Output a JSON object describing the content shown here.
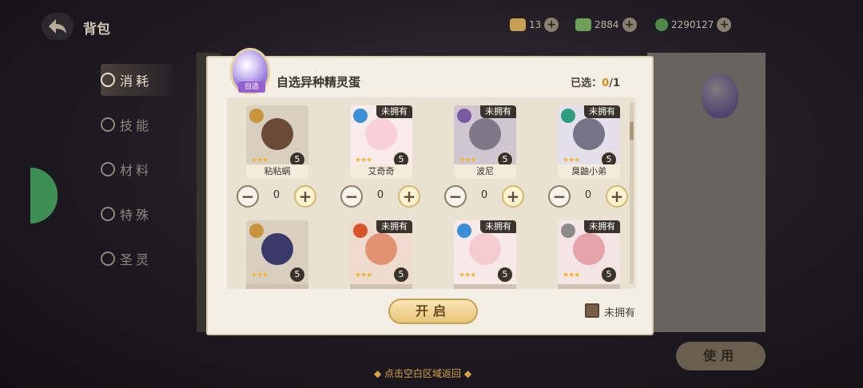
{
  "header": {
    "title": "背包",
    "currencies": [
      {
        "name": "gold-ticket",
        "value": "13"
      },
      {
        "name": "green-gem",
        "value": "2884"
      },
      {
        "name": "coin",
        "value": "2290127"
      }
    ]
  },
  "sidebar": {
    "items": [
      {
        "label": "消耗",
        "active": true
      },
      {
        "label": "技能",
        "active": false
      },
      {
        "label": "材料",
        "active": false
      },
      {
        "label": "特殊",
        "active": false
      },
      {
        "label": "圣灵",
        "active": false
      }
    ]
  },
  "dialog": {
    "title": "自选异种精灵蛋",
    "egg_tag": "自选",
    "selected_label": "已选：",
    "selected_count": "0",
    "selected_total": "/1",
    "open_button": "开启",
    "filter_label": "未拥有",
    "filter_checked": true,
    "not_owned_tag": "未拥有",
    "pets": [
      {
        "name": "粘粘蜗",
        "level": "5",
        "stars": "★★★",
        "owned": true,
        "element": "gold",
        "count": "0",
        "color": "#6b4a3a"
      },
      {
        "name": "艾奇奇",
        "level": "5",
        "stars": "★★★",
        "owned": false,
        "element": "water",
        "count": "0",
        "color": "#f3b9c2"
      },
      {
        "name": "波尼",
        "level": "5",
        "stars": "★★★",
        "owned": false,
        "element": "dark",
        "count": "0",
        "color": "#3b3248"
      },
      {
        "name": "臭鼬小弟",
        "level": "5",
        "stars": "★★★",
        "owned": false,
        "element": "wind",
        "count": "0",
        "color": "#2d2a45"
      },
      {
        "name": "",
        "level": "5",
        "stars": "★★★",
        "owned": true,
        "element": "gold",
        "count": "",
        "color": "#3a3a6a"
      },
      {
        "name": "",
        "level": "5",
        "stars": "★★★",
        "owned": false,
        "element": "fire",
        "count": "",
        "color": "#d35a2a"
      },
      {
        "name": "",
        "level": "5",
        "stars": "★★★",
        "owned": false,
        "element": "water",
        "count": "",
        "color": "#f0b3b8"
      },
      {
        "name": "",
        "level": "5",
        "stars": "★★★",
        "owned": false,
        "element": "normal",
        "count": "",
        "color": "#d8707a"
      }
    ]
  },
  "right_panel": {
    "use_button": "使用"
  },
  "footer": {
    "hint": "◆ 点击空白区域返回 ◆"
  },
  "colors": {
    "accent_gold": "#d9a441",
    "dialog_bg": "#f4efe4",
    "element_gold": "#c9953a",
    "element_water": "#3b8fd6",
    "element_dark": "#7a5aa0",
    "element_wind": "#2f9c7e",
    "element_fire": "#d9532a",
    "element_normal": "#8a8a8a"
  }
}
